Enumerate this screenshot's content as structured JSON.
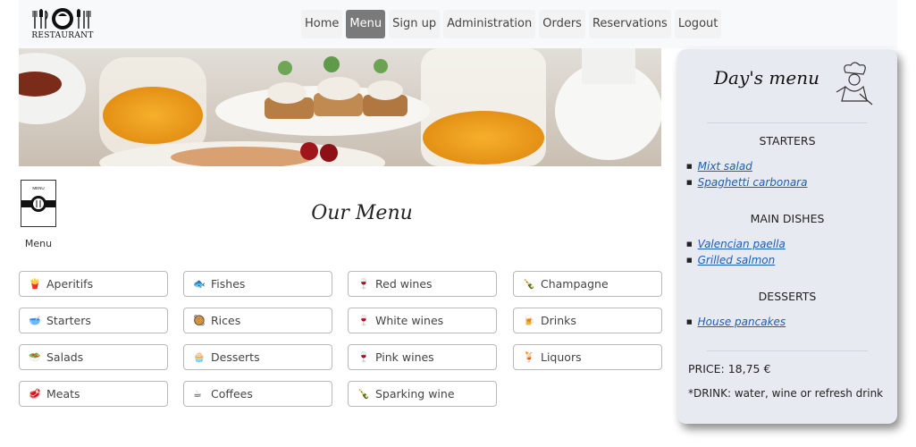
{
  "brand": {
    "logo_text": "RESTAURANT"
  },
  "nav": {
    "items": [
      {
        "label": "Home"
      },
      {
        "label": "Menu"
      },
      {
        "label": "Sign up"
      },
      {
        "label": "Administration"
      },
      {
        "label": "Orders"
      },
      {
        "label": "Reservations"
      },
      {
        "label": "Logout"
      }
    ],
    "active": "Menu"
  },
  "badge": {
    "small_text": "MENU",
    "label": "Menu"
  },
  "main": {
    "title": "Our Menu"
  },
  "categories": [
    {
      "label": "Aperitifs",
      "icon": "fries-icon",
      "glyph": "🍟"
    },
    {
      "label": "Fishes",
      "icon": "fish-icon",
      "glyph": "🐟"
    },
    {
      "label": "Red wines",
      "icon": "wine-glass-icon",
      "glyph": "🍷"
    },
    {
      "label": "Champagne",
      "icon": "bottle-icon",
      "glyph": "🍾"
    },
    {
      "label": "Starters",
      "icon": "bowl-icon",
      "glyph": "🥣"
    },
    {
      "label": "Rices",
      "icon": "paella-icon",
      "glyph": "🥘"
    },
    {
      "label": "White wines",
      "icon": "wine-glass-icon",
      "glyph": "🍷"
    },
    {
      "label": "Drinks",
      "icon": "beer-icon",
      "glyph": "🍺"
    },
    {
      "label": "Salads",
      "icon": "salad-icon",
      "glyph": "🥗"
    },
    {
      "label": "Desserts",
      "icon": "cupcake-icon",
      "glyph": "🧁"
    },
    {
      "label": "Pink wines",
      "icon": "wine-glass-icon",
      "glyph": "🍷"
    },
    {
      "label": "Liquors",
      "icon": "cocktail-icon",
      "glyph": "🍹"
    },
    {
      "label": "Meats",
      "icon": "meat-icon",
      "glyph": "🥩"
    },
    {
      "label": "Coffees",
      "icon": "coffee-icon",
      "glyph": "☕"
    },
    {
      "label": "Sparking wine",
      "icon": "bottle-icon",
      "glyph": "🍾"
    }
  ],
  "days_menu": {
    "title": "Day's menu",
    "sections": [
      {
        "heading": "STARTERS",
        "items": [
          "Mixt salad",
          "Spaghetti carbonara"
        ]
      },
      {
        "heading": "MAIN DISHES",
        "items": [
          "Valencian paella",
          "Grilled salmon"
        ]
      },
      {
        "heading": "DESSERTS",
        "items": [
          "House pancakes"
        ]
      }
    ],
    "price": "PRICE: 18,75 €",
    "drink": "*DRINK: water, wine or refresh drink"
  },
  "colors": {
    "active_nav": "#7a7a7a",
    "link": "#1a5fb4",
    "card_bg": "#e8eaf2"
  }
}
